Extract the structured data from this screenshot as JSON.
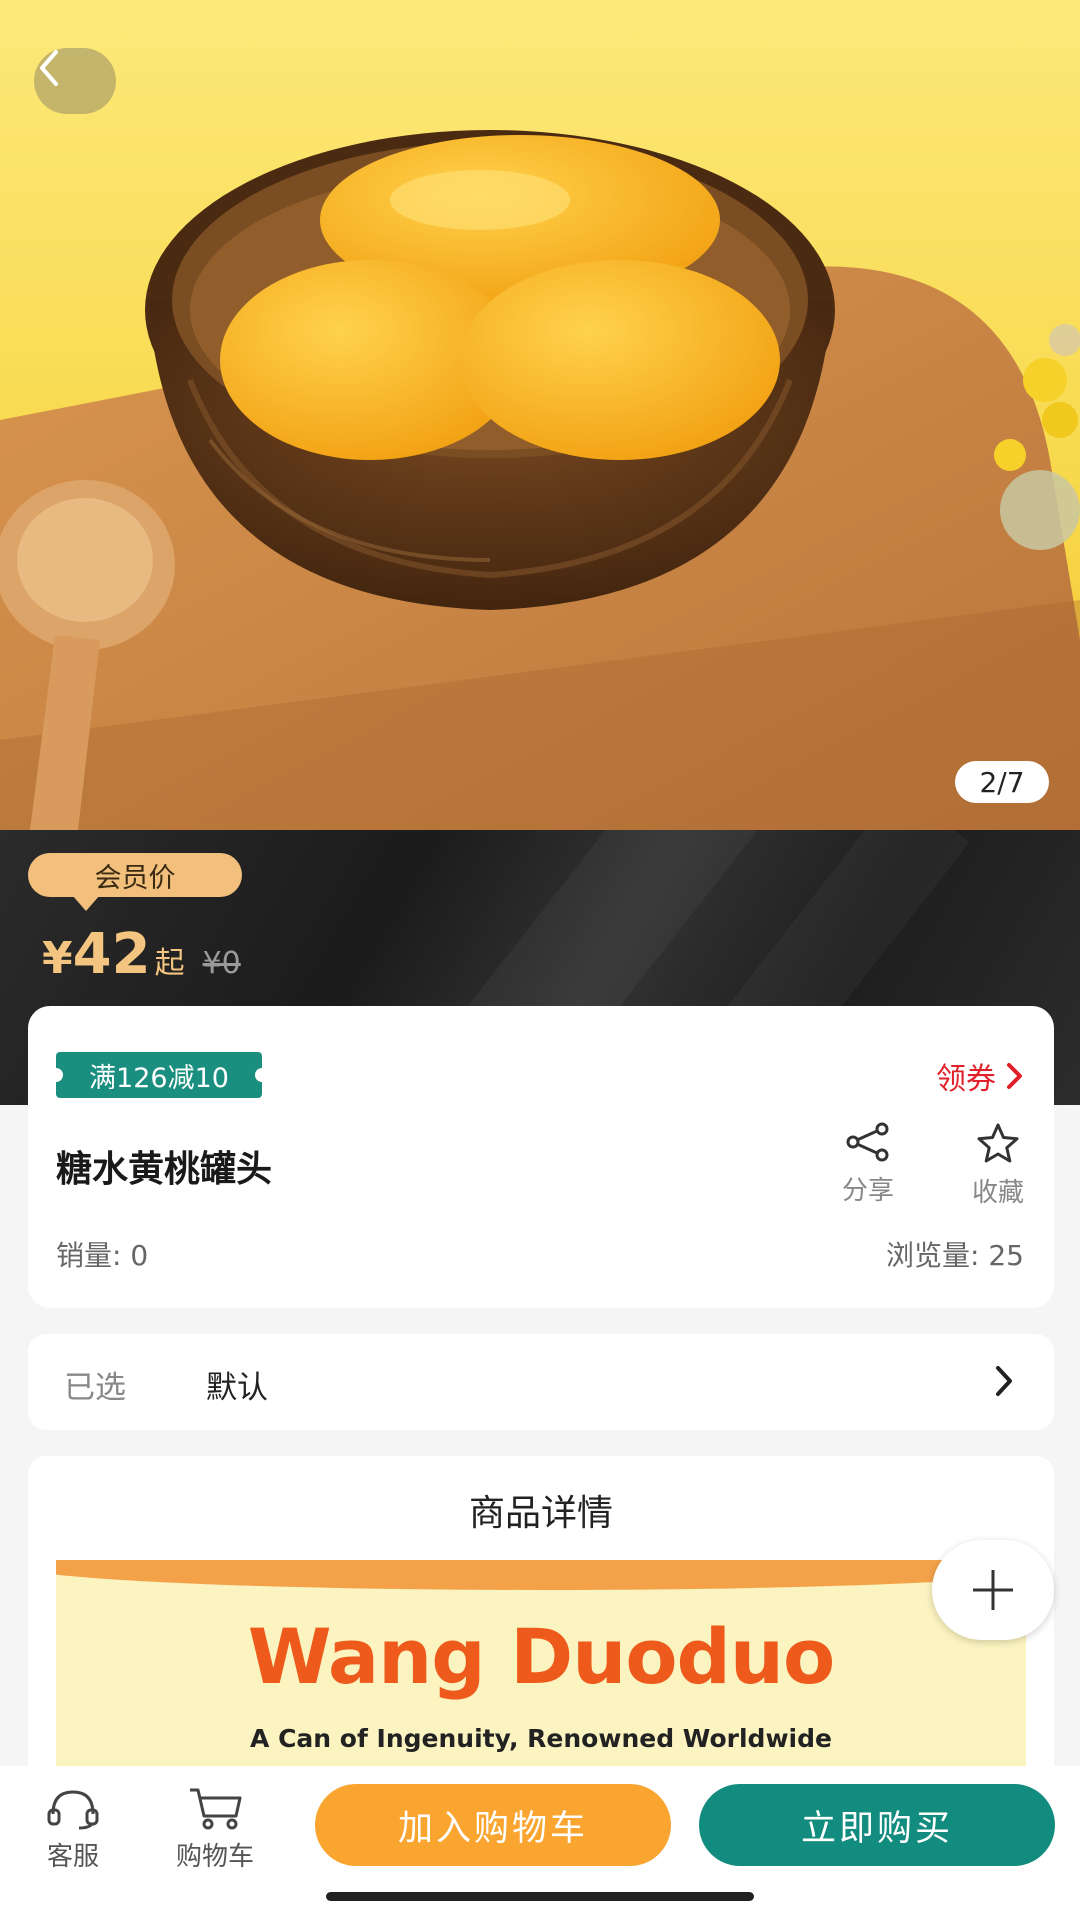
{
  "gallery": {
    "counter": "2/7"
  },
  "price": {
    "member_tag": "会员价",
    "currency": "¥",
    "value": "42",
    "suffix": "起",
    "original": "¥0"
  },
  "promo": {
    "coupon_badge": "满126减10",
    "get_coupon": "领券"
  },
  "product": {
    "title": "糖水黄桃罐头",
    "share_label": "分享",
    "favorite_label": "收藏",
    "sales": "销量: 0",
    "views": "浏览量: 25"
  },
  "selection": {
    "label": "已选",
    "value": "默认"
  },
  "detail": {
    "title": "商品详情",
    "brand": "Wang Duoduo",
    "slogan": "A Can of Ingenuity, Renowned Worldwide"
  },
  "bottom_bar": {
    "service_label": "客服",
    "cart_label": "购物车",
    "add_to_cart": "加入购物车",
    "buy_now": "立即购买"
  },
  "colors": {
    "accent_orange": "#f9a530",
    "accent_green": "#128c7e",
    "coupon_red": "#e0202a",
    "gold": "#f4c580"
  }
}
